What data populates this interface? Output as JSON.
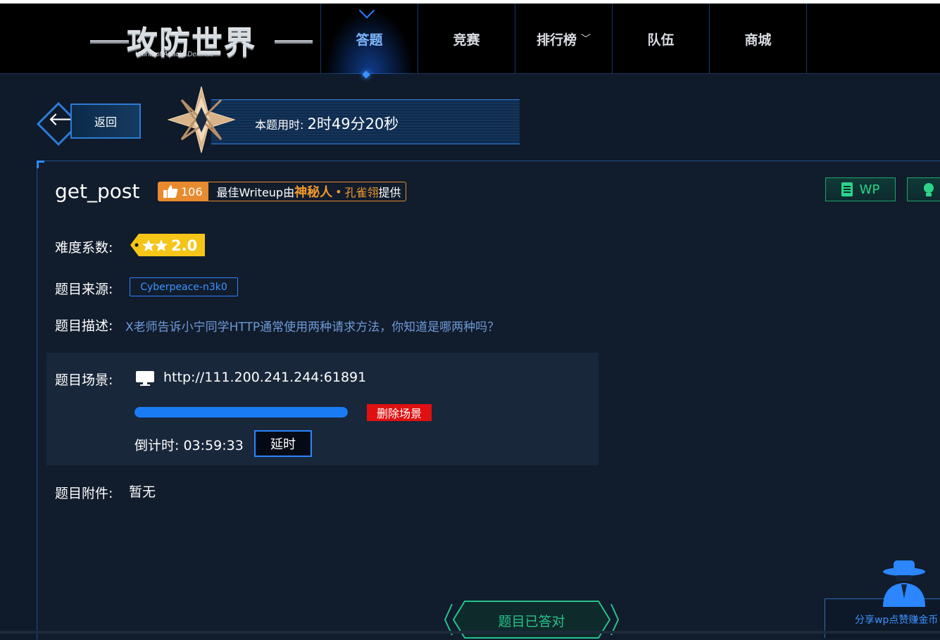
{
  "nav": {
    "logo_title": "攻防世界",
    "logo_subtitle": "World of Attack&Defense",
    "items": [
      {
        "label": "答题",
        "active": true
      },
      {
        "label": "竞赛",
        "active": false
      },
      {
        "label": "排行榜",
        "active": false,
        "has_dropdown": true
      },
      {
        "label": "队伍",
        "active": false
      },
      {
        "label": "商城",
        "active": false
      }
    ]
  },
  "header": {
    "back_label": "返回",
    "timer_label": "本题用时: ",
    "timer_value": "2时49分20秒"
  },
  "challenge": {
    "title": "get_post",
    "likes": "106",
    "writeup_prefix": "最佳Writeup由",
    "writeup_name1": "神秘人",
    "writeup_dot": "•",
    "writeup_name2": "孔雀翎",
    "writeup_suffix": "提供",
    "wp_label": "WP",
    "difficulty_label": "难度系数:",
    "difficulty_value": "2.0",
    "difficulty_stars": 2,
    "source_label": "题目来源:",
    "source_value": "Cyberpeace-n3k0",
    "desc_label": "题目描述:",
    "desc_value": "X老师告诉小宁同学HTTP通常使用两种请求方法，你知道是哪两种吗？",
    "scene_label": "题目场景:",
    "scene_url": "http://111.200.241.244:61891",
    "scene_progress": 1.0,
    "delete_label": "删除场景",
    "countdown_label": "倒计时: ",
    "countdown_value": "03:59:33",
    "extend_label": "延时",
    "attach_label": "题目附件:",
    "attach_value": "暂无",
    "solved_label": "题目已答对"
  },
  "share": {
    "label": "分享wp点赞赚金币"
  },
  "colors": {
    "accent": "#2b86ff",
    "writeup_orange": "#e88a2e",
    "danger": "#e01010",
    "success": "#25c28c",
    "star_yellow": "#f5c518"
  }
}
